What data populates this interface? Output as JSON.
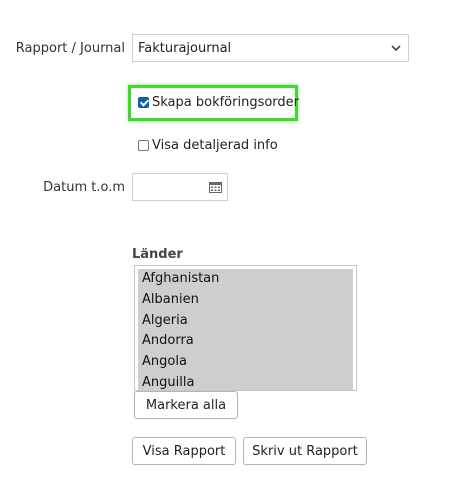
{
  "form": {
    "report_label": "Rapport / Journal",
    "report_value": "Fakturajournal",
    "create_order_label": "Skapa bokföringsorder",
    "create_order_checked": true,
    "show_details_label": "Visa detaljerad info",
    "show_details_checked": false,
    "date_label": "Datum t.o.m",
    "date_value": ""
  },
  "countries": {
    "label": "Länder",
    "items": [
      "Afghanistan",
      "Albanien",
      "Algeria",
      "Andorra",
      "Angola",
      "Anguilla"
    ]
  },
  "buttons": {
    "select_all": "Markera alla",
    "show_report": "Visa Rapport",
    "print_report": "Skriv ut Rapport"
  },
  "colors": {
    "highlight": "#3ddc2b",
    "selected_bg": "#cecece",
    "checkbox_checked": "#0b5fa5"
  },
  "icons": {
    "select": "chevron-down-icon",
    "date": "calendar-icon"
  }
}
